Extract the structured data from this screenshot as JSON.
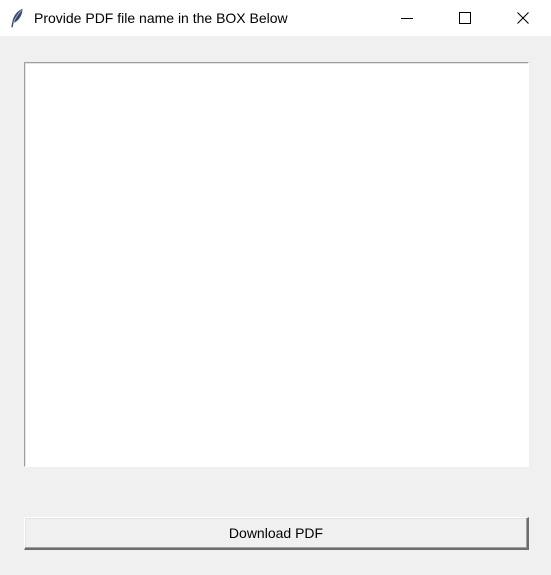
{
  "window": {
    "title": "Provide PDF file name in the BOX Below",
    "app_icon": "feather-icon",
    "controls": {
      "minimize_icon": "minimize-icon",
      "maximize_icon": "maximize-icon",
      "close_icon": "close-icon"
    }
  },
  "main": {
    "text_input": {
      "value": "",
      "placeholder": ""
    },
    "download_button": {
      "label": "Download PDF"
    }
  }
}
